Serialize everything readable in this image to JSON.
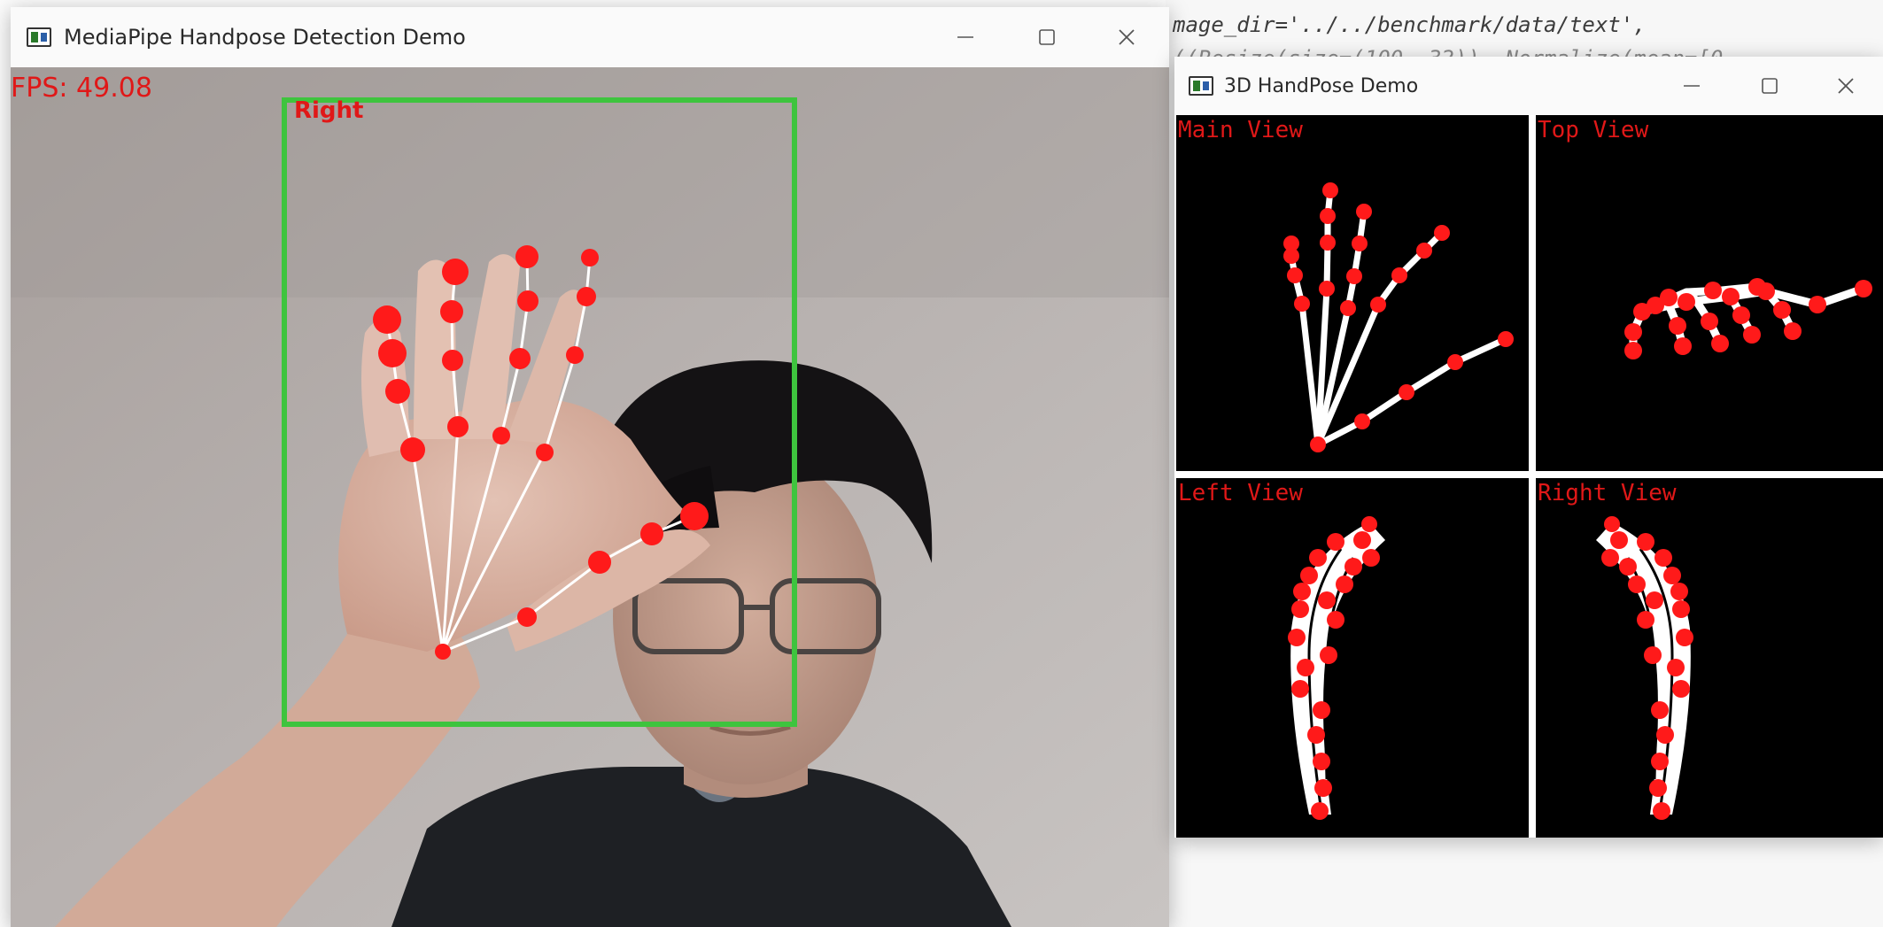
{
  "background_editor": {
    "line1": "mage_dir='../../benchmark/data/text',",
    "line2": "        ((Resize(size=(100, 32)), Normalize(mean=[0."
  },
  "main_window": {
    "title": "MediaPipe Handpose Detection Demo",
    "icon": "opencv-window-icon",
    "controls": {
      "minimize": "minimize-icon",
      "maximize": "maximize-icon",
      "close": "close-icon"
    },
    "overlay": {
      "fps": "FPS: 49.08",
      "handedness": "Right",
      "bbox_color": "#3ec43e",
      "landmark_color": "#ff1a1a",
      "bone_color": "#ffffff"
    }
  },
  "hand3d_window": {
    "title": "3D HandPose Demo",
    "icon": "opencv-window-icon",
    "controls": {
      "minimize": "minimize-icon",
      "maximize": "maximize-icon",
      "close": "close-icon"
    },
    "views": {
      "main": "Main View",
      "top": "Top View",
      "left": "Left View",
      "right": "Right View"
    }
  }
}
